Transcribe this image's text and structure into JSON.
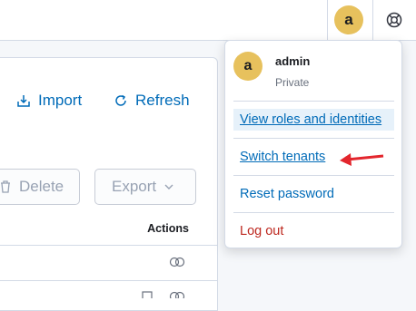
{
  "header": {
    "avatar_initial": "a",
    "help_icon": "help-lifebuoy-icon"
  },
  "toolbar": {
    "import_label": "Import",
    "refresh_label": "Refresh",
    "delete_label": "Delete",
    "export_label": "Export"
  },
  "table": {
    "actions_header": "Actions"
  },
  "user_menu": {
    "avatar_initial": "a",
    "username": "admin",
    "tenant": "Private",
    "items": [
      {
        "label": "View roles and identities"
      },
      {
        "label": "Switch tenants"
      },
      {
        "label": "Reset password"
      },
      {
        "label": "Log out"
      }
    ]
  },
  "colors": {
    "link": "#006bb8",
    "danger": "#bd271e",
    "avatar": "#e7c15d",
    "arrow": "#e3262d"
  }
}
